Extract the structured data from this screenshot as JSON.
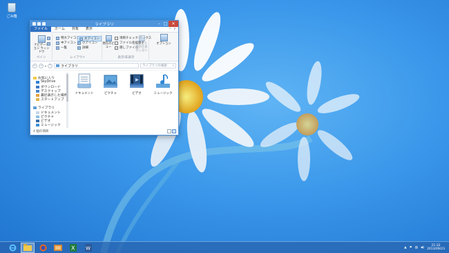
{
  "desktop": {
    "recycle_bin_label": "ごみ箱"
  },
  "window": {
    "title": "ライブラリ",
    "tabs": [
      "ファイル",
      "ホーム",
      "共有",
      "表示"
    ],
    "ribbon": {
      "pane_group": {
        "label": "ペイン",
        "nav_pane": "ナビゲーション ウィンドウ"
      },
      "layout_group": {
        "label": "レイアウト",
        "items": [
          "特大アイコン",
          "中アイコン",
          "一覧",
          "大アイコン",
          "小アイコン",
          "詳細"
        ]
      },
      "current_view_group": {
        "label": "表示/非表示",
        "sort_label": "現在のビュー",
        "checkboxes": [
          {
            "label": "項目チェック ボックス",
            "checked": false
          },
          {
            "label": "ファイル名拡張子",
            "checked": false
          },
          {
            "label": "隠しファイル",
            "checked": true
          }
        ],
        "hide_selected": "選択した項目を表示しない",
        "options": "オプション"
      }
    },
    "address": {
      "path": "ライブラリ",
      "search_placeholder": "ライブラリの検索"
    },
    "nav_items": [
      {
        "label": "お気に入り",
        "color": "#f2c94c"
      },
      {
        "label": "SkyDrive",
        "color": "#2f7fd3"
      },
      {
        "label": "ダウンロード",
        "color": "#3a78c9"
      },
      {
        "label": "デスクトップ",
        "color": "#4a86c8"
      },
      {
        "label": "最近表示した場所",
        "color": "#e7a23d"
      },
      {
        "label": "スタートアップ",
        "color": "#e2b64d"
      },
      {
        "label": "ライブラリ",
        "color": "#5e9ed8"
      },
      {
        "label": "ドキュメント",
        "color": "#c9d7e6"
      },
      {
        "label": "ピクチャ",
        "color": "#8cc0e6"
      },
      {
        "label": "ビデオ",
        "color": "#3a6ea8"
      },
      {
        "label": "ミュージック",
        "color": "#3a8fd6"
      }
    ],
    "libraries": [
      {
        "label": "ドキュメント",
        "icon": "documents-icon"
      },
      {
        "label": "ピクチャ",
        "icon": "pictures-icon"
      },
      {
        "label": "ビデオ",
        "icon": "videos-icon"
      },
      {
        "label": "ミュージック",
        "icon": "music-icon"
      }
    ],
    "status": "4 個の項目"
  },
  "taskbar": {
    "apps": [
      "internet-explorer-icon",
      "file-explorer-icon",
      "firefox-icon",
      "folder-icon",
      "excel-icon",
      "word-icon"
    ],
    "time": "21:32",
    "date": "2013/09/23"
  }
}
